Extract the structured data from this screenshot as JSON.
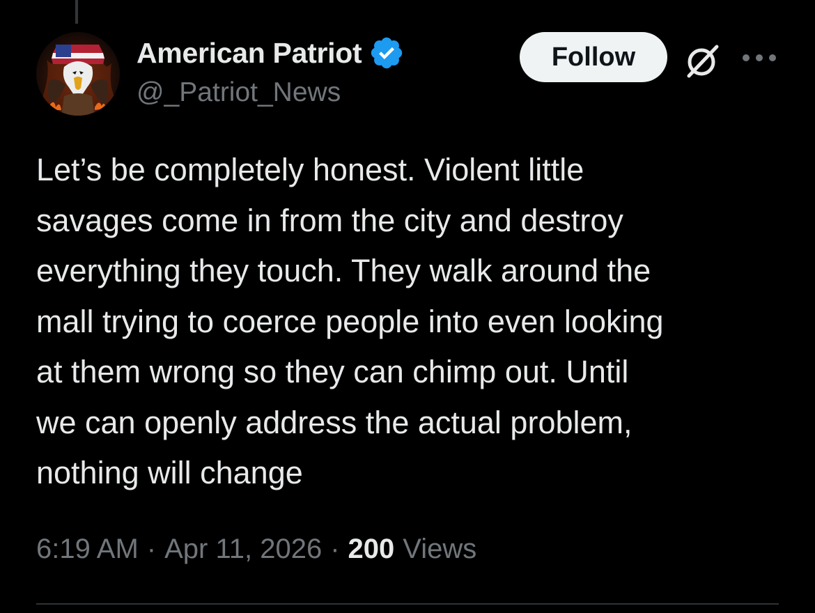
{
  "post": {
    "author": {
      "display_name": "American Patriot",
      "handle": "@_Patriot_News",
      "verified": true,
      "avatar_icon": "eagle-flag-avatar",
      "verified_icon": "verified-badge-icon",
      "verified_color": "#1d9bf0"
    },
    "actions": {
      "follow_label": "Follow",
      "grok_icon": "grok-icon",
      "more_icon": "more-options-icon"
    },
    "text": "Let’s be completely honest. Violent little\nsavages come in from the city and destroy\neverything they touch. They walk around the\nmall trying to coerce people into even looking\nat them wrong so they can chimp out. Until\nwe can openly address the actual problem,\nnothing will change",
    "meta": {
      "time": "6:19 AM",
      "separator": "·",
      "date": "Apr 11, 2026",
      "views_count": "200",
      "views_label": "Views"
    }
  },
  "colors": {
    "background": "#000000",
    "primary_text": "#e7e9ea",
    "secondary_text": "#71767b",
    "follow_button_bg": "#eff3f4",
    "follow_button_text": "#0f1419",
    "divider": "#2f3336"
  }
}
